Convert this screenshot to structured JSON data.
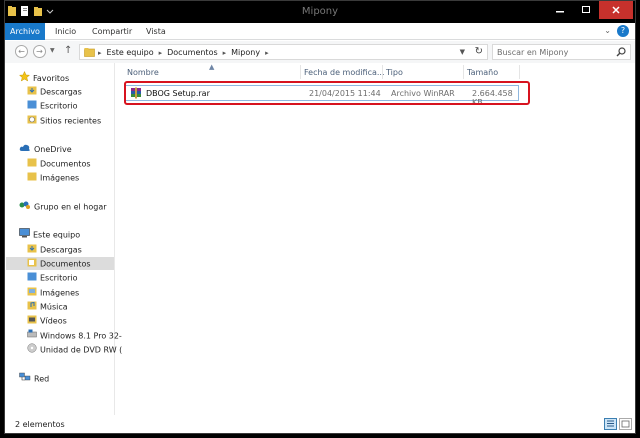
{
  "window": {
    "title": "Mipony",
    "colors": {
      "accent": "#1979ca",
      "close": "#c7312c",
      "highlight": "#d7131f"
    }
  },
  "ribbon": {
    "tabs": [
      {
        "label": "Archivo"
      },
      {
        "label": "Inicio"
      },
      {
        "label": "Compartir"
      },
      {
        "label": "Vista"
      }
    ],
    "help_label": "?"
  },
  "address": {
    "crumbs": [
      "Este equipo",
      "Documentos",
      "Mipony"
    ],
    "search_placeholder": "Buscar en Mipony"
  },
  "nav": {
    "groups": [
      {
        "label": "Favoritos",
        "icon": "star-icon",
        "items": [
          {
            "label": "Descargas",
            "icon": "downloads-folder-icon"
          },
          {
            "label": "Escritorio",
            "icon": "desktop-folder-icon"
          },
          {
            "label": "Sitios recientes",
            "icon": "recent-places-icon"
          }
        ]
      },
      {
        "label": "OneDrive",
        "icon": "cloud-icon",
        "items": [
          {
            "label": "Documentos",
            "icon": "documents-folder-icon"
          },
          {
            "label": "Imágenes",
            "icon": "pictures-folder-icon"
          }
        ]
      },
      {
        "label": "Grupo en el hogar",
        "icon": "homegroup-icon",
        "items": []
      },
      {
        "label": "Este equipo",
        "icon": "computer-icon",
        "items": [
          {
            "label": "Descargas",
            "icon": "downloads-folder-icon"
          },
          {
            "label": "Documentos",
            "icon": "documents-folder-icon",
            "selected": true
          },
          {
            "label": "Escritorio",
            "icon": "desktop-folder-icon"
          },
          {
            "label": "Imágenes",
            "icon": "pictures-folder-icon"
          },
          {
            "label": "Música",
            "icon": "music-folder-icon"
          },
          {
            "label": "Vídeos",
            "icon": "videos-folder-icon"
          },
          {
            "label": "Windows 8.1 Pro 32-",
            "icon": "drive-icon"
          },
          {
            "label": "Unidad de DVD RW (",
            "icon": "dvd-drive-icon"
          }
        ]
      },
      {
        "label": "Red",
        "icon": "network-icon",
        "items": []
      }
    ]
  },
  "columns": [
    "Nombre",
    "Fecha de modifica...",
    "Tipo",
    "Tamaño"
  ],
  "files": [
    {
      "name": "DBOG Setup.rar",
      "modified": "21/04/2015 11:44",
      "type": "Archivo WinRAR",
      "size": "2.664.458 KB",
      "icon": "winrar-archive-icon"
    }
  ],
  "status": {
    "count": "2 elementos"
  }
}
